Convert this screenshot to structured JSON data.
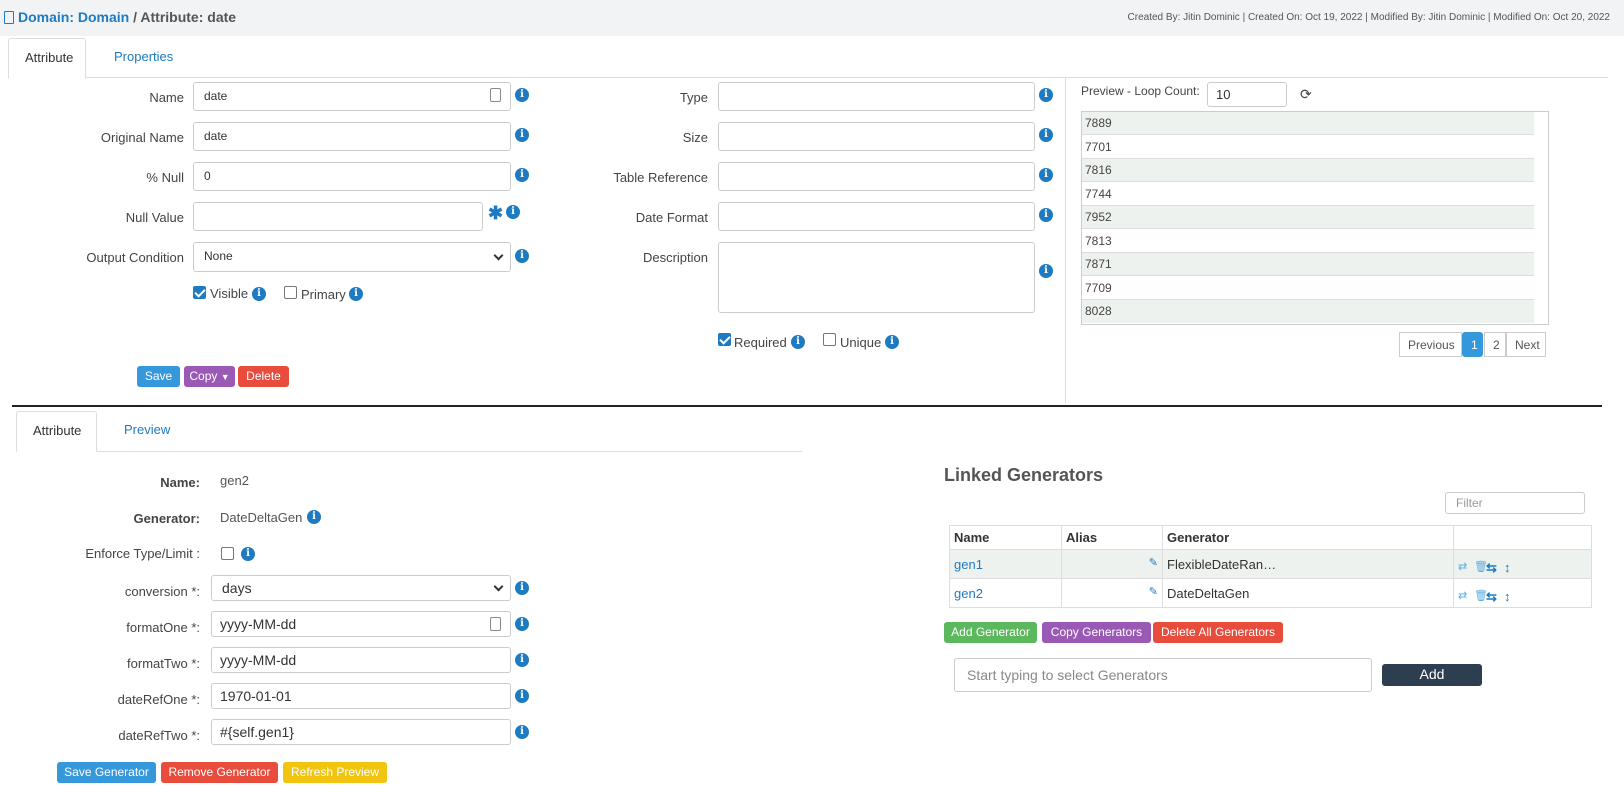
{
  "header": {
    "domain_link": "Domain: Domain",
    "separator": "/",
    "attribute_title": "Attribute: date",
    "meta": "Created By: Jitin Dominic | Created On: Oct 19, 2022 | Modified By: Jitin Dominic | Modified On: Oct 20, 2022"
  },
  "top_tabs": [
    "Attribute",
    "Properties"
  ],
  "form": {
    "name_label": "Name",
    "name_value": "date",
    "original_name_label": "Original Name",
    "original_name_value": "date",
    "null_pct_label": "% Null",
    "null_pct_value": "0",
    "null_value_label": "Null Value",
    "null_value_value": "",
    "output_condition_label": "Output Condition",
    "output_condition_value": "None",
    "visible_label": "Visible",
    "primary_label": "Primary",
    "type_label": "Type",
    "type_value": "",
    "size_label": "Size",
    "size_value": "",
    "table_ref_label": "Table Reference",
    "table_ref_value": "",
    "date_format_label": "Date Format",
    "date_format_value": "",
    "description_label": "Description",
    "description_value": "",
    "required_label": "Required",
    "unique_label": "Unique",
    "visible_checked": true,
    "primary_checked": false,
    "required_checked": true,
    "unique_checked": false
  },
  "actions": {
    "save": "Save",
    "copy": "Copy",
    "delete": "Delete"
  },
  "preview": {
    "loop_label": "Preview - Loop Count:",
    "loop_value": "10",
    "rows": [
      "7889",
      "7701",
      "7816",
      "7744",
      "7952",
      "7813",
      "7871",
      "7709",
      "8028"
    ],
    "pager": {
      "previous": "Previous",
      "pages": [
        "1",
        "2"
      ],
      "current": "1",
      "next": "Next"
    }
  },
  "gen_tabs": [
    "Attribute",
    "Preview"
  ],
  "generator": {
    "name_label": "Name:",
    "name_value": "gen2",
    "gen_label": "Generator:",
    "gen_value": "DateDeltaGen",
    "enforce_label": "Enforce Type/Limit :",
    "enforce_checked": false,
    "conversion_label": "conversion *:",
    "conversion_value": "days",
    "format_one_label": "formatOne *:",
    "format_one_value": "yyyy-MM-dd",
    "format_two_label": "formatTwo *:",
    "format_two_value": "yyyy-MM-dd",
    "date_ref_one_label": "dateRefOne *:",
    "date_ref_one_value": "1970-01-01",
    "date_ref_two_label": "dateRefTwo *:",
    "date_ref_two_value": "#{self.gen1}",
    "buttons": {
      "save": "Save Generator",
      "remove": "Remove Generator",
      "refresh": "Refresh Preview"
    }
  },
  "linked": {
    "title": "Linked Generators",
    "filter_placeholder": "Filter",
    "columns": [
      "Name",
      "Alias",
      "Generator"
    ],
    "rows": [
      {
        "name": "gen1",
        "alias": "",
        "generator": "FlexibleDateRan…"
      },
      {
        "name": "gen2",
        "alias": "",
        "generator": "DateDeltaGen"
      }
    ],
    "buttons": {
      "add": "Add Generator",
      "copy": "Copy Generators",
      "delete_all": "Delete All Generators"
    },
    "select_placeholder": "Start typing to select Generators",
    "add_button": "Add"
  },
  "colors": {
    "link": "#1f7bc1",
    "save": "#3498db",
    "copy": "#9b59b6",
    "delete": "#e74c3c",
    "add": "#5cb85c",
    "refresh": "#f1c40f",
    "add_dark": "#2c3e50"
  }
}
